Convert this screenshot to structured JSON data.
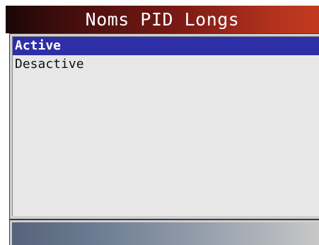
{
  "header": {
    "title": "Noms PID Longs"
  },
  "menu": {
    "items": [
      {
        "label": "Active",
        "selected": true
      },
      {
        "label": "Desactive",
        "selected": false
      }
    ]
  },
  "colors": {
    "selection": "#2e2fa6",
    "title_gradient_start": "#1a0606",
    "title_gradient_end": "#c23a1e",
    "panel_background": "#e7e7e7"
  }
}
